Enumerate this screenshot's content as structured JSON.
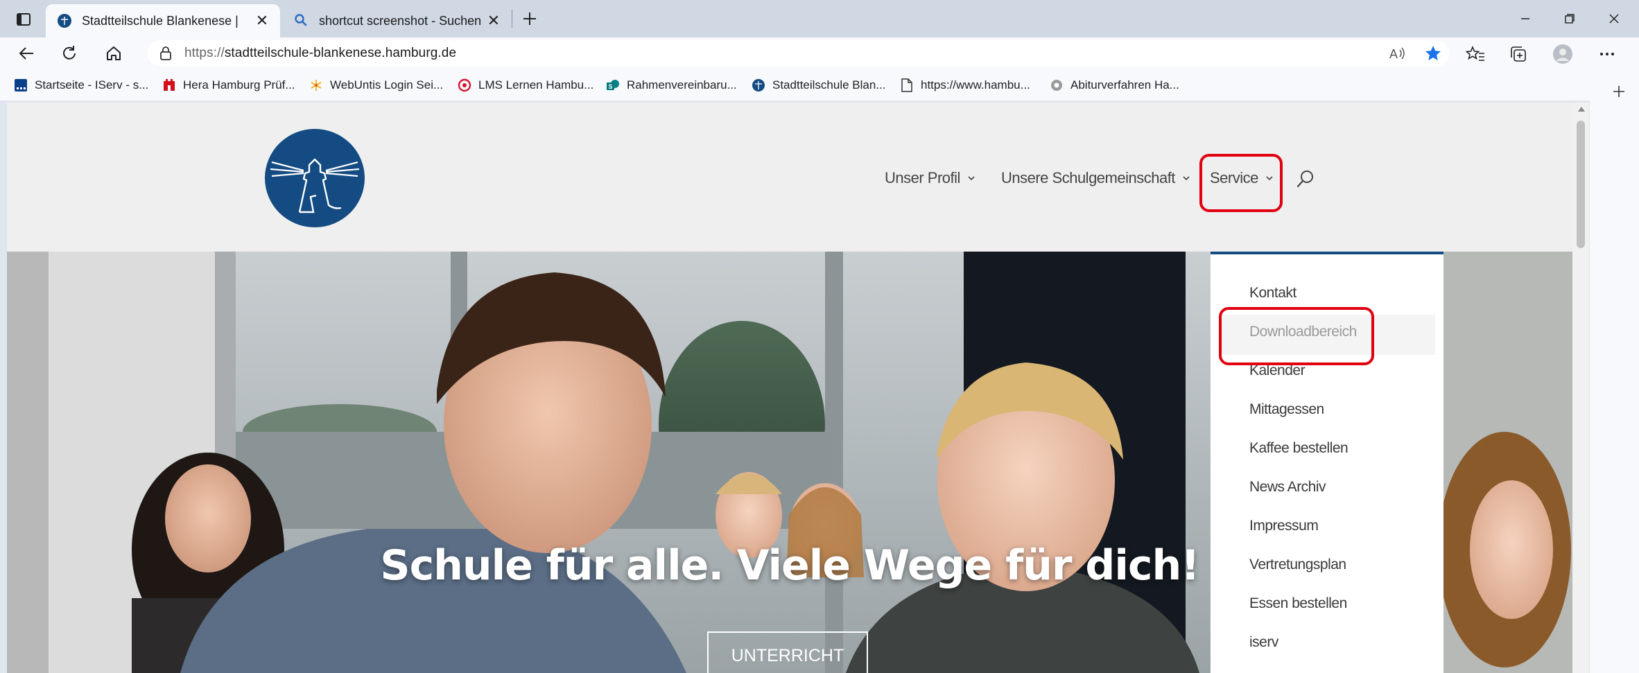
{
  "browser": {
    "tabs": [
      {
        "title": "Stadtteilschule Blankenese |",
        "active": true,
        "icon": "school-logo-icon"
      },
      {
        "title": "shortcut screenshot - Suchen",
        "active": false,
        "icon": "search-icon"
      }
    ],
    "address": {
      "scheme": "https://",
      "host": "stadtteilschule-blankenese.hamburg.de"
    },
    "bookmarks": [
      {
        "label": "Startseite - IServ - s...",
        "icon": "iserv-icon"
      },
      {
        "label": "Hera Hamburg Prüf...",
        "icon": "hamburg-flag-icon"
      },
      {
        "label": "WebUntis Login Sei...",
        "icon": "webuntis-icon"
      },
      {
        "label": "LMS Lernen Hambu...",
        "icon": "lms-icon"
      },
      {
        "label": "Rahmenvereinbaru...",
        "icon": "sharepoint-icon"
      },
      {
        "label": "Stadtteilschule Blan...",
        "icon": "school-logo-icon"
      },
      {
        "label": "https://www.hambu...",
        "icon": "page-icon"
      },
      {
        "label": "Abiturverfahren Ha...",
        "icon": "circle-icon"
      }
    ]
  },
  "site": {
    "menu": [
      {
        "label": "Unser Profil"
      },
      {
        "label": "Unsere Schulgemeinschaft"
      },
      {
        "label": "Service",
        "highlighted": true
      }
    ],
    "dropdown": [
      "Kontakt",
      "Downloadbereich",
      "Kalender",
      "Mittagessen",
      "Kaffee bestellen",
      "News Archiv",
      "Impressum",
      "Vertretungsplan",
      "Essen bestellen",
      "iserv"
    ],
    "hovered_dropdown_item": "Downloadbereich",
    "hero": {
      "title": "Schule für alle. Viele Wege für dich!",
      "cta": "UNTERRICHT"
    }
  },
  "colors": {
    "brand_blue": "#144b82",
    "highlight_red": "#e00010",
    "star_blue": "#1a73e8"
  }
}
